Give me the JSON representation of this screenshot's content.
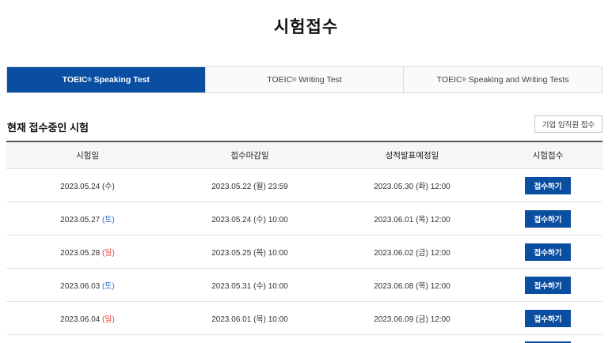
{
  "page_title": "시험접수",
  "tabs": [
    {
      "label": "TOEIC",
      "sup": "®",
      "suffix": " Speaking Test",
      "active": true
    },
    {
      "label": "TOEIC",
      "sup": "®",
      "suffix": " Writing Test",
      "active": false
    },
    {
      "label": "TOEIC",
      "sup": "®",
      "suffix": " Speaking and Writing Tests",
      "active": false
    }
  ],
  "section_title": "현재 접수중인 시험",
  "corporate_button": "기업 임직원 접수",
  "table": {
    "headers": [
      "시험일",
      "접수마감일",
      "성적발표예정일",
      "시험접수"
    ],
    "apply_label": "접수하기",
    "rows": [
      {
        "test_date": "2023.05.24 ",
        "test_day": "(수)",
        "day_type": "weekday",
        "deadline": "2023.05.22 (월) 23:59",
        "result": "2023.05.30 (화) 12:00"
      },
      {
        "test_date": "2023.05.27 ",
        "test_day": "(토)",
        "day_type": "sat",
        "deadline": "2023.05.24 (수) 10:00",
        "result": "2023.06.01 (목) 12:00"
      },
      {
        "test_date": "2023.05.28 ",
        "test_day": "(일)",
        "day_type": "sun",
        "deadline": "2023.05.25 (목) 10:00",
        "result": "2023.06.02 (금) 12:00"
      },
      {
        "test_date": "2023.06.03 ",
        "test_day": "(토)",
        "day_type": "sat",
        "deadline": "2023.05.31 (수) 10:00",
        "result": "2023.06.08 (목) 12:00"
      },
      {
        "test_date": "2023.06.04 ",
        "test_day": "(일)",
        "day_type": "sun",
        "deadline": "2023.06.01 (목) 10:00",
        "result": "2023.06.09 (금) 12:00"
      }
    ]
  },
  "colors": {
    "accent": "#0a4ea2",
    "saturday": "#2f6fd6",
    "sunday": "#e0453a"
  }
}
